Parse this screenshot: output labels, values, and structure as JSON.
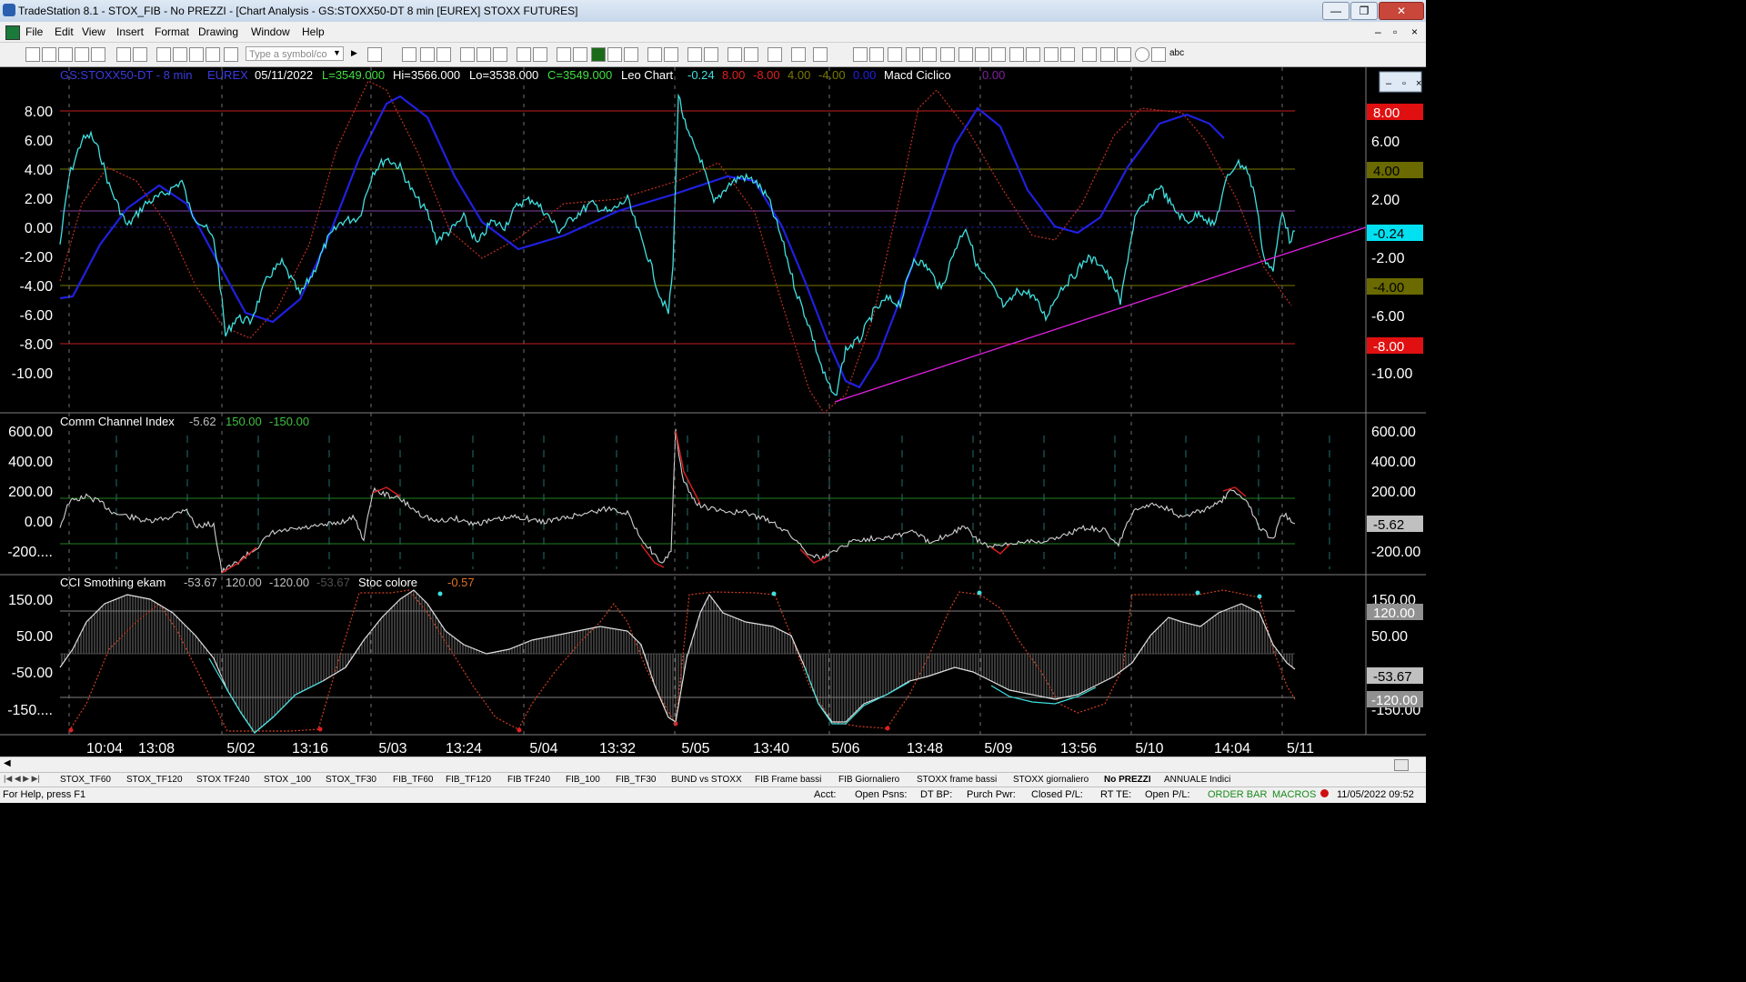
{
  "window": {
    "title": "TradeStation 8.1 - STOX_FIB - No PREZZI - [Chart Analysis - GS:STOXX50-DT  8 min  [EUREX] STOXX FUTURES]",
    "minimize": "—",
    "restore": "❐",
    "close": "✕",
    "child_minimize": "–",
    "child_restore": "▫",
    "child_close": "×"
  },
  "menu": [
    "File",
    "Edit",
    "View",
    "Insert",
    "Format",
    "Drawing",
    "Window",
    "Help"
  ],
  "toolbar": {
    "symbol_placeholder": "Type a symbol/co",
    "text_tool": "abc"
  },
  "chart": {
    "header": {
      "symbol": "GS:STOXX50-DT - 8 min",
      "exchange": "EUREX",
      "date": "05/11/2022",
      "last": "L=3549.000",
      "hi": "Hi=3566.000",
      "lo": "Lo=3538.000",
      "close": "C=3549.000",
      "study": "Leo Chart",
      "v1": "-0.24",
      "v2": "8.00",
      "v3": "-8.00",
      "v4": "4.00",
      "v5": "-4.00",
      "v6": "0.00",
      "study2": "Macd Ciclico",
      "v7": "0.00"
    },
    "colors": {
      "cyan": "#40e0e0",
      "blue": "#2020e0",
      "red": "#c03020",
      "olive": "#7a7a00",
      "purple": "#8040a0",
      "magenta": "#e020e0",
      "grey": "#808080"
    },
    "panel1_axis": [
      "8.00",
      "6.00",
      "4.00",
      "2.00",
      "0.00",
      "-2.00",
      "-4.00",
      "-6.00",
      "-8.00",
      "-10.00"
    ],
    "panel1_right_axis": [
      "6.00",
      "2.00",
      "-2.00",
      "-6.00",
      "-10.00"
    ],
    "panel1_badges": {
      "plus8": "8.00",
      "plus4": "4.00",
      "last": "-0.24",
      "minus4": "-4.00",
      "minus8": "-8.00"
    },
    "panel2": {
      "label": "Comm Channel Index",
      "value": "-5.62",
      "upper": "150.00",
      "lower": "-150.00",
      "axis": [
        "600.00",
        "400.00",
        "200.00",
        "0.00",
        "-200...."
      ],
      "right_axis": [
        "600.00",
        "400.00",
        "200.00",
        "-200.00"
      ],
      "badge": "-5.62"
    },
    "panel3": {
      "label": "CCI Smothing ekam",
      "value": "-53.67",
      "upper": "120.00",
      "lower": "-120.00",
      "value2": "-53.67",
      "label2": "Stoc colore",
      "value3": "-0.57",
      "axis": [
        "150.00",
        "50.00",
        "-50.00",
        "-150...."
      ],
      "right_axis": [
        "150.00",
        "50.00",
        "-150.00"
      ],
      "badges": {
        "upper": "120.00",
        "value": "-53.67",
        "lower": "-120.00"
      }
    },
    "time_axis": [
      "10:04",
      "13:08",
      "5/02",
      "13:16",
      "5/03",
      "13:24",
      "5/04",
      "13:32",
      "5/05",
      "13:40",
      "5/06",
      "13:48",
      "5/09",
      "13:56",
      "5/10",
      "14:04",
      "5/11"
    ]
  },
  "tabs": [
    "STOX_TF60",
    "STOX_TF120",
    "STOX TF240",
    "STOX _100",
    "STOX_TF30",
    "FIB_TF60",
    "FIB_TF120",
    "FIB TF240",
    "FIB_100",
    "FIB_TF30",
    "BUND vs STOXX",
    "FIB Frame bassi",
    "FIB Giornaliero",
    "STOXX frame bassi",
    "STOXX giornaliero",
    "No PREZZI",
    "ANNUALE Indici"
  ],
  "active_tab": "No PREZZI",
  "status": {
    "help": "For Help, press F1",
    "acct": "Acct:",
    "open_psns": "Open Psns:",
    "dt_bp": "DT BP:",
    "purch_pwr": "Purch Pwr:",
    "closed_pl": "Closed P/L:",
    "rt_te": "RT TE:",
    "open_pl": "Open P/L:",
    "order_bar": "ORDER BAR",
    "macros": "MACROS",
    "datetime": "11/05/2022 09:52"
  }
}
